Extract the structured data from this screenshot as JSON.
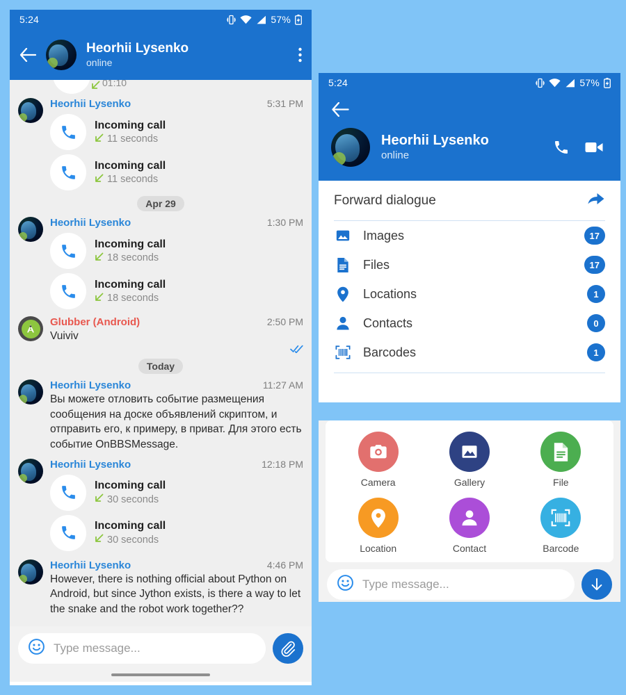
{
  "theme": {
    "page_background": "#80c4f7",
    "header_blue": "#1b72ce",
    "chat_background": "#efefef",
    "sender_name_color": "#2a86d8",
    "bot_name_color": "#e8584f",
    "accent_blue": "#1b72ce",
    "call_arrow_green": "#8dc63f"
  },
  "status_bar": {
    "clock": "5:24",
    "battery_percent": "57%",
    "icons": [
      "vibrate-icon",
      "wifi-icon",
      "signal-icon",
      "battery-icon"
    ]
  },
  "panel1": {
    "appbar": {
      "back_icon": "arrow-left-icon",
      "avatar": "contact-avatar",
      "title": "Heorhii Lysenko",
      "subtitle": "online",
      "overflow_icon": "more-vertical-icon"
    },
    "cut_off_message": {
      "duration": "01:10"
    },
    "messages": [
      {
        "type": "calls",
        "sender": "Heorhii Lysenko",
        "sender_type": "user",
        "time": "5:31 PM",
        "calls": [
          {
            "title": "Incoming call",
            "duration": "11 seconds",
            "direction": "incoming"
          },
          {
            "title": "Incoming call",
            "duration": "11 seconds",
            "direction": "incoming"
          }
        ]
      },
      {
        "type": "date",
        "label": "Apr 29"
      },
      {
        "type": "calls",
        "sender": "Heorhii Lysenko",
        "sender_type": "user",
        "time": "1:30 PM",
        "calls": [
          {
            "title": "Incoming call",
            "duration": "18 seconds",
            "direction": "incoming"
          },
          {
            "title": "Incoming call",
            "duration": "18 seconds",
            "direction": "incoming"
          }
        ]
      },
      {
        "type": "text",
        "sender": "Glubber (Android)",
        "sender_type": "bot",
        "time": "2:50 PM",
        "text": "Vuiviv",
        "read_receipt": "double-check-icon"
      },
      {
        "type": "date",
        "label": "Today"
      },
      {
        "type": "text",
        "sender": "Heorhii Lysenko",
        "sender_type": "user",
        "time": "11:27 AM",
        "text": "Вы можете отловить событие размещения сообщения на доске объявлений скриптом, и отправить его, к примеру, в приват. Для этого есть событие OnBBSMessage."
      },
      {
        "type": "calls",
        "sender": "Heorhii Lysenko",
        "sender_type": "user",
        "time": "12:18 PM",
        "calls": [
          {
            "title": "Incoming call",
            "duration": "30 seconds",
            "direction": "incoming"
          },
          {
            "title": "Incoming call",
            "duration": "30 seconds",
            "direction": "incoming"
          }
        ]
      },
      {
        "type": "text",
        "sender": "Heorhii Lysenko",
        "sender_type": "user",
        "time": "4:46 PM",
        "text": "However, there is nothing official about Python on Android, but since Jython exists, is there a way to let the snake and the robot work together??"
      }
    ],
    "composer": {
      "emoji_icon": "smiley-icon",
      "placeholder": "Type message...",
      "value": "",
      "action_icon": "paperclip-icon"
    }
  },
  "panel2": {
    "header": {
      "back_icon": "arrow-left-icon",
      "title": "Heorhii Lysenko",
      "subtitle": "online",
      "call_icon": "phone-icon",
      "video_icon": "video-camera-icon"
    },
    "forward": {
      "label": "Forward dialogue",
      "icon": "share-arrow-icon"
    },
    "list": [
      {
        "icon": "image-icon",
        "label": "Images",
        "count": "17"
      },
      {
        "icon": "file-icon",
        "label": "Files",
        "count": "17"
      },
      {
        "icon": "location-icon",
        "label": "Locations",
        "count": "1"
      },
      {
        "icon": "person-icon",
        "label": "Contacts",
        "count": "0"
      },
      {
        "icon": "barcode-icon",
        "label": "Barcodes",
        "count": "1"
      }
    ],
    "attachments": [
      {
        "icon": "camera-icon",
        "label": "Camera",
        "color": "#e2706e"
      },
      {
        "icon": "gallery-icon",
        "label": "Gallery",
        "color": "#2e4283"
      },
      {
        "icon": "file-icon",
        "label": "File",
        "color": "#4cae50"
      },
      {
        "icon": "location-icon",
        "label": "Location",
        "color": "#f79a23"
      },
      {
        "icon": "contact-icon",
        "label": "Contact",
        "color": "#ab4ed8"
      },
      {
        "icon": "barcode-icon",
        "label": "Barcode",
        "color": "#36b0e2"
      }
    ],
    "composer": {
      "emoji_icon": "smiley-icon",
      "placeholder": "Type message...",
      "value": "",
      "action_icon": "arrow-down-icon"
    }
  }
}
